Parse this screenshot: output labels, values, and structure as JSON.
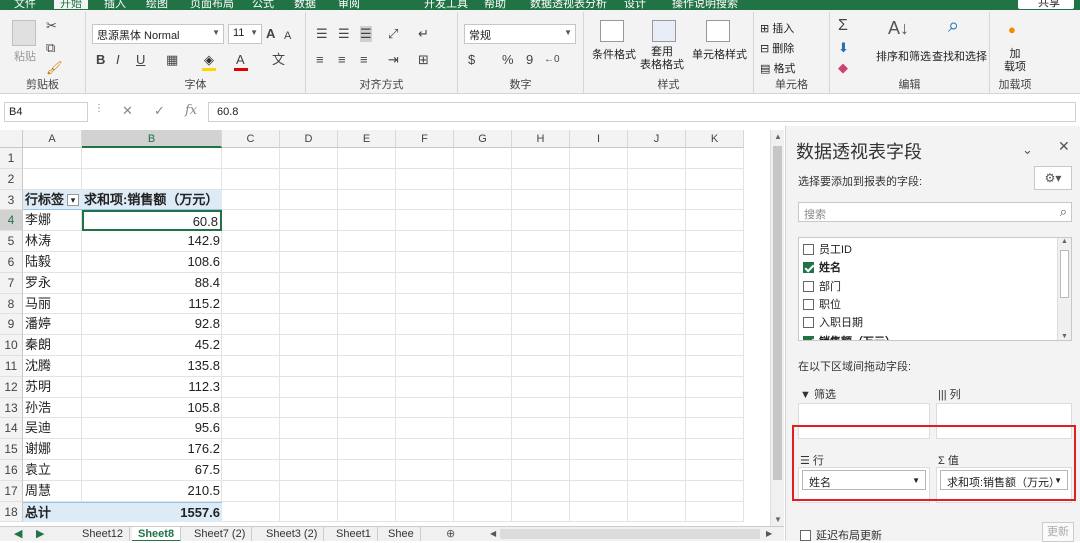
{
  "ribbon_tabs": [
    "文件",
    "开始",
    "插入",
    "绘图",
    "页面布局",
    "公式",
    "数据",
    "审阅",
    "开发工具",
    "帮助",
    "数据透视表分析",
    "设计",
    "操作说明搜索"
  ],
  "share_label": "共享",
  "ribbon": {
    "clipboard": {
      "paste": "粘贴",
      "label": "剪贴板"
    },
    "font": {
      "name": "思源黑体 Normal",
      "size": "11",
      "bold": "B",
      "italic": "I",
      "underline": "U",
      "grow": "A",
      "shrink": "A",
      "font_color_glyph": "A",
      "phonetic": "文",
      "label": "字体"
    },
    "alignment": {
      "label": "对齐方式"
    },
    "number": {
      "format": "常规",
      "percent": "%",
      "comma": "9",
      "label": "数字"
    },
    "styles": {
      "conditional": "条件格式",
      "table_fmt": "套用\n表格格式",
      "cell_styles": "单元格样式",
      "label": "样式"
    },
    "cells": {
      "insert": "插入",
      "delete": "删除",
      "format": "格式",
      "label": "单元格"
    },
    "editing": {
      "sigma": "Σ",
      "sort": "排序和筛选",
      "find": "查找和选择",
      "label": "编辑"
    },
    "addins": {
      "addin": "加\n载项",
      "label": "加载项"
    }
  },
  "formula_bar": {
    "name_box": "B4",
    "value": "60.8",
    "fx": "fx"
  },
  "columns": [
    "A",
    "B",
    "C",
    "D",
    "E",
    "F",
    "G",
    "H",
    "I",
    "J",
    "K"
  ],
  "rows": [
    "1",
    "2",
    "3",
    "4",
    "5",
    "6",
    "7",
    "8",
    "9",
    "10",
    "11",
    "12",
    "13",
    "14",
    "15",
    "16",
    "17",
    "18"
  ],
  "pivot": {
    "header_row": "行标签",
    "header_value": "求和项:销售额（万元）",
    "items": [
      {
        "name": "李娜",
        "value": "60.8"
      },
      {
        "name": "林涛",
        "value": "142.9"
      },
      {
        "name": "陆毅",
        "value": "108.6"
      },
      {
        "name": "罗永",
        "value": "88.4"
      },
      {
        "name": "马丽",
        "value": "115.2"
      },
      {
        "name": "潘婷",
        "value": "92.8"
      },
      {
        "name": "秦朗",
        "value": "45.2"
      },
      {
        "name": "沈腾",
        "value": "135.8"
      },
      {
        "name": "苏明",
        "value": "112.3"
      },
      {
        "name": "孙浩",
        "value": "105.8"
      },
      {
        "name": "吴迪",
        "value": "95.6"
      },
      {
        "name": "谢娜",
        "value": "176.2"
      },
      {
        "name": "袁立",
        "value": "67.5"
      },
      {
        "name": "周慧",
        "value": "210.5"
      }
    ],
    "total_label": "总计",
    "total_value": "1557.6"
  },
  "sheet_tabs": [
    "Sheet12",
    "Sheet8",
    "Sheet7 (2)",
    "Sheet3 (2)",
    "Sheet1",
    "Shee"
  ],
  "active_sheet": "Sheet8",
  "pane": {
    "title": "数据透视表字段",
    "subtitle": "选择要添加到报表的字段:",
    "search_placeholder": "搜索",
    "fields": [
      {
        "label": "员工ID",
        "checked": false
      },
      {
        "label": "姓名",
        "checked": true
      },
      {
        "label": "部门",
        "checked": false
      },
      {
        "label": "职位",
        "checked": false
      },
      {
        "label": "入职日期",
        "checked": false
      },
      {
        "label": "销售额（万元）",
        "checked": true
      }
    ],
    "drag_hint": "在以下区域间拖动字段:",
    "filter_label": "筛选",
    "columns_label": "列",
    "rows_label": "行",
    "values_label": "值",
    "rows_field": "姓名",
    "values_field": "求和项:销售额（万元）",
    "defer_label": "延迟布局更新",
    "update_button": "更新"
  },
  "colors": {
    "accent": "#217346",
    "highlight_border": "#e02020",
    "header_fill": "#ddebf7"
  }
}
